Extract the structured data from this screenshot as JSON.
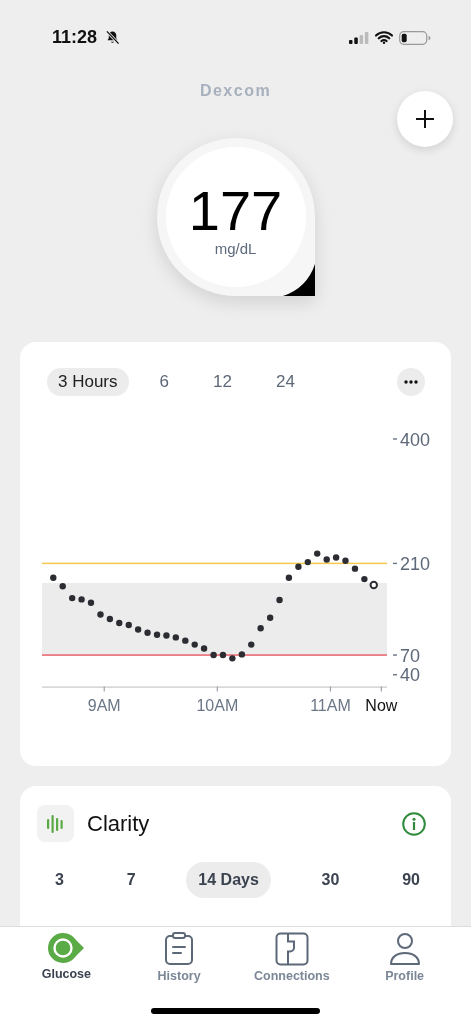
{
  "status_bar": {
    "time": "11:28"
  },
  "header": {
    "logo": "Dexcom"
  },
  "reading": {
    "value": "177",
    "unit": "mg/dL"
  },
  "glucose_card": {
    "ranges": [
      {
        "label": "3 Hours",
        "selected": true
      },
      {
        "label": "6",
        "selected": false
      },
      {
        "label": "12",
        "selected": false
      },
      {
        "label": "24",
        "selected": false
      }
    ],
    "chart_data": {
      "type": "scatter",
      "xlim": [
        8.45,
        11.5
      ],
      "ylim": [
        22,
        400
      ],
      "xticks": [
        {
          "value": 9,
          "label": "9AM"
        },
        {
          "value": 10,
          "label": "10AM"
        },
        {
          "value": 11,
          "label": "11AM"
        },
        {
          "value": 11.45,
          "label": "Now"
        }
      ],
      "yticks": [
        400,
        210,
        70,
        40
      ],
      "x": [
        8.55,
        8.633,
        8.717,
        8.8,
        8.883,
        8.967,
        9.05,
        9.133,
        9.217,
        9.3,
        9.383,
        9.467,
        9.55,
        9.633,
        9.717,
        9.8,
        9.883,
        9.967,
        10.05,
        10.133,
        10.217,
        10.3,
        10.383,
        10.467,
        10.55,
        10.633,
        10.717,
        10.8,
        10.883,
        10.967,
        11.05,
        11.133,
        11.217,
        11.3,
        11.383
      ],
      "series": [
        {
          "color": "#2b2d33",
          "values": [
            188,
            175,
            157,
            155,
            150,
            132,
            125,
            119,
            116,
            109,
            104,
            101,
            100,
            97,
            92,
            86,
            80,
            70,
            70,
            65,
            71,
            86,
            111,
            127,
            154,
            188,
            205,
            212,
            225,
            216,
            219,
            214,
            202,
            186,
            177
          ]
        }
      ],
      "bands": [
        {
          "axis": "y",
          "from": 70,
          "to": 180
        }
      ],
      "ref_lines": [
        {
          "axis": "y",
          "value": 210,
          "color": "#f2c94c"
        },
        {
          "axis": "y",
          "value": 70,
          "color": "#e8636b"
        }
      ]
    }
  },
  "clarity_card": {
    "title": "Clarity",
    "periods": [
      {
        "label": "3",
        "selected": false
      },
      {
        "label": "7",
        "selected": false
      },
      {
        "label": "14 Days",
        "selected": true
      },
      {
        "label": "30",
        "selected": false
      },
      {
        "label": "90",
        "selected": false
      }
    ]
  },
  "nav": [
    {
      "label": "Glucose",
      "selected": true,
      "kind": "glucose"
    },
    {
      "label": "History",
      "selected": false,
      "kind": "history"
    },
    {
      "label": "Connections",
      "selected": false,
      "kind": "connections"
    },
    {
      "label": "Profile",
      "selected": false,
      "kind": "profile"
    }
  ]
}
